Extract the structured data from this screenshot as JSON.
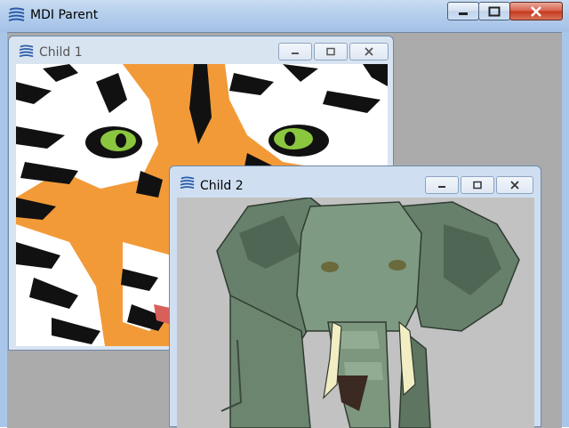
{
  "parent": {
    "title": "MDI Parent",
    "icon": "app-lines-icon",
    "buttons": {
      "minimize": "minimize-icon",
      "maximize": "maximize-icon",
      "close": "close-icon"
    }
  },
  "children": [
    {
      "title": "Child 1",
      "state": "inactive",
      "content": "tiger-image",
      "buttons": {
        "minimize": "minimize-icon",
        "maximize": "maximize-icon",
        "close": "close-icon"
      }
    },
    {
      "title": "Child 2",
      "state": "active",
      "content": "elephant-image",
      "buttons": {
        "minimize": "minimize-icon",
        "maximize": "maximize-icon",
        "close": "close-icon"
      }
    }
  ],
  "colors": {
    "titlebar": "#b3cdec",
    "mdi_background": "#ababab",
    "tiger_orange": "#f29a38",
    "tiger_eye": "#8bc63f",
    "elephant_green": "#6f8a74",
    "elephant_bg": "#c2c2c2"
  }
}
